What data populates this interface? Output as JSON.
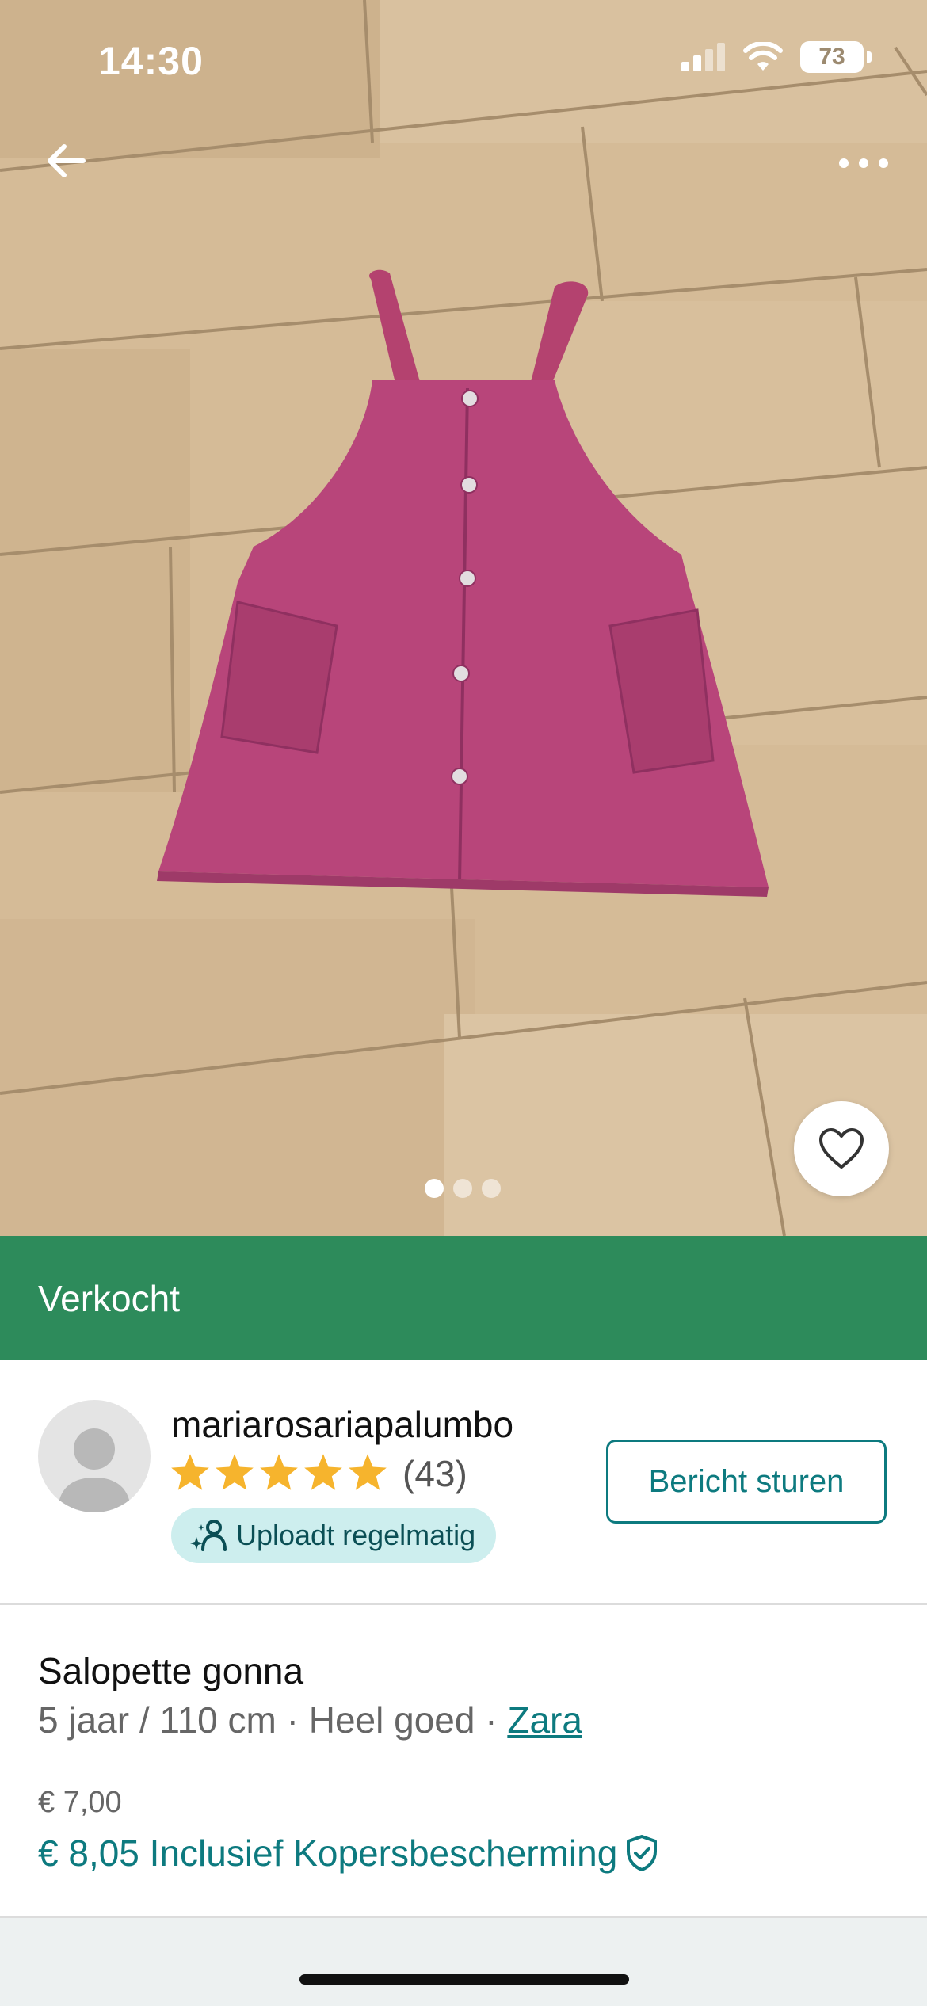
{
  "status_bar": {
    "time": "14:30",
    "battery": "73"
  },
  "photo": {
    "icon_back": "arrow-left-icon",
    "icon_more": "more-dots-icon",
    "icon_favorite": "heart-icon",
    "page_count": 3,
    "active_page": 1
  },
  "sold_banner": {
    "label": "Verkocht",
    "color": "#2d8b5b"
  },
  "seller": {
    "name": "mariarosariapalumbo",
    "rating_stars": 5,
    "rating_count": "(43)",
    "badge_label": "Uploadt regelmatig",
    "message_button": "Bericht sturen"
  },
  "item": {
    "title": "Salopette gonna",
    "size": "5 jaar / 110 cm",
    "separator": " · ",
    "condition": "Heel goed",
    "brand": "Zara",
    "price": "€ 7,00",
    "price_total": "€ 8,05 Inclusief Kopersbescherming"
  },
  "colors": {
    "accent": "#0d7a7f",
    "star": "#f6b42d"
  }
}
